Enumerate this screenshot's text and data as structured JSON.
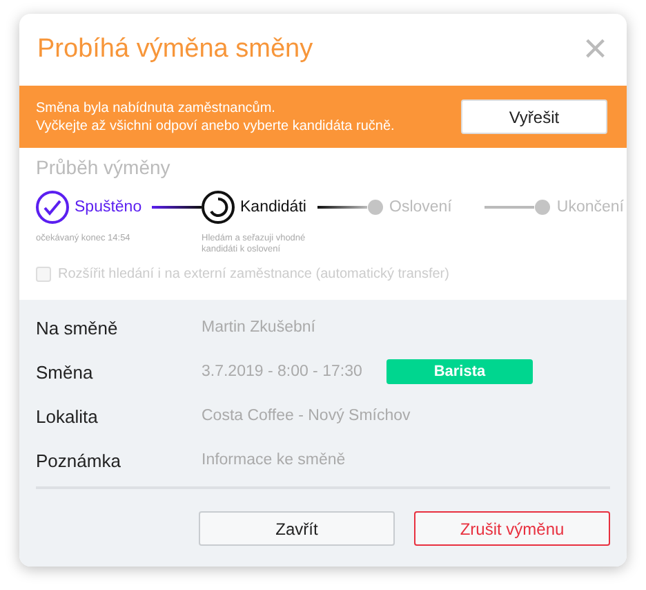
{
  "dialog": {
    "title": "Probíhá výměna směny",
    "close_label": "×"
  },
  "banner": {
    "lines": [
      "Směna byla nabídnuta zaměstnancům.",
      "Vyčkejte až všichni odpoví anebo vyberte kandidáta ručně."
    ],
    "button": "Vyřešit"
  },
  "progress": {
    "heading": "Průběh výměny",
    "steps": [
      {
        "label": "Spuštěno",
        "kind": "done",
        "note": "očekávaný konec 14:54"
      },
      {
        "label": "Kandidáti",
        "kind": "active",
        "note": "Hledám a seřazuji vhodné kandidáti k oslovení"
      },
      {
        "label": "Oslovení",
        "kind": "pending"
      },
      {
        "label": "Ukončení",
        "kind": "pending"
      }
    ],
    "option": {
      "label": "Rozšířit hledání i na externí zaměstnance (automatický transfer)",
      "checked": false,
      "disabled": true
    }
  },
  "details": [
    {
      "label": "Na směně",
      "value": "Martin Zkušební"
    },
    {
      "label": "Směna",
      "value": "3.7.2019 - 8:00 - 17:30",
      "tag": {
        "text": "Barista",
        "color": "#00d68f"
      }
    },
    {
      "label": "Lokalita",
      "value": "Costa Coffee - Nový Smíchov"
    },
    {
      "label": "Poznámka",
      "value": "Informace ke směně"
    }
  ],
  "buttons": [
    {
      "label": "Zavřít",
      "kind": "secondary"
    },
    {
      "label": "Zrušit výměnu",
      "kind": "danger"
    }
  ]
}
